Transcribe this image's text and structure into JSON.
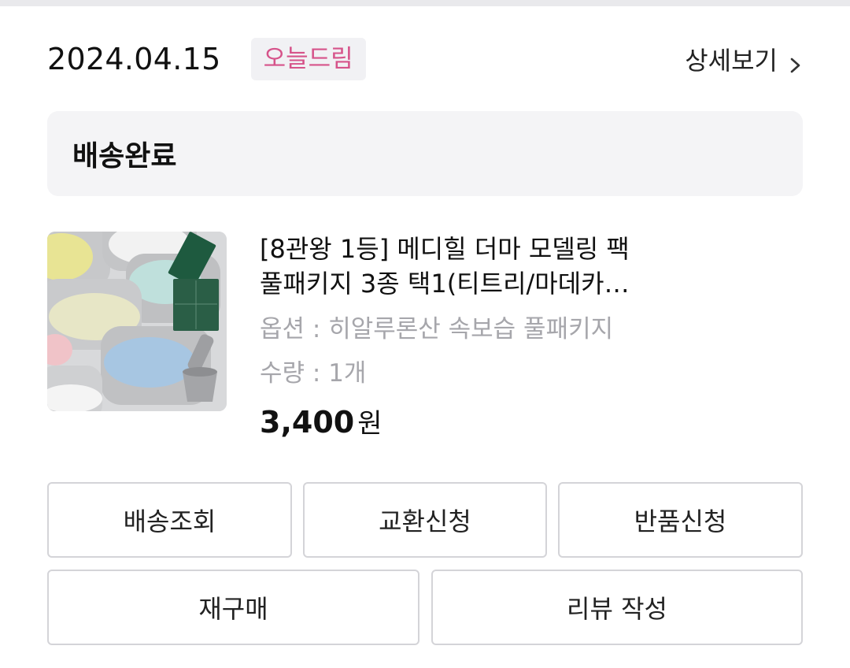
{
  "order": {
    "date": "2024.04.15",
    "delivery_badge": "오늘드림",
    "detail_link": "상세보기",
    "status": "배송완료"
  },
  "product": {
    "title_line1": "[8관왕 1등] 메디힐 더마 모델링 팩",
    "title_line2": "풀패키지 3종 택1(티트리/마데카…",
    "option": "옵션 : 히알루론산 속보습 풀패키지",
    "quantity": "수량 : 1개",
    "price": "3,400",
    "currency": "원"
  },
  "actions": {
    "track": "배송조회",
    "exchange": "교환신청",
    "return": "반품신청",
    "rebuy": "재구매",
    "review": "리뷰 작성"
  },
  "colors": {
    "badge_text": "#d6538a",
    "badge_bg": "#f1f1f4",
    "status_bg": "#f4f4f6",
    "button_border": "#d4d4d8"
  },
  "icons": {
    "detail": "chevron-right-icon"
  }
}
